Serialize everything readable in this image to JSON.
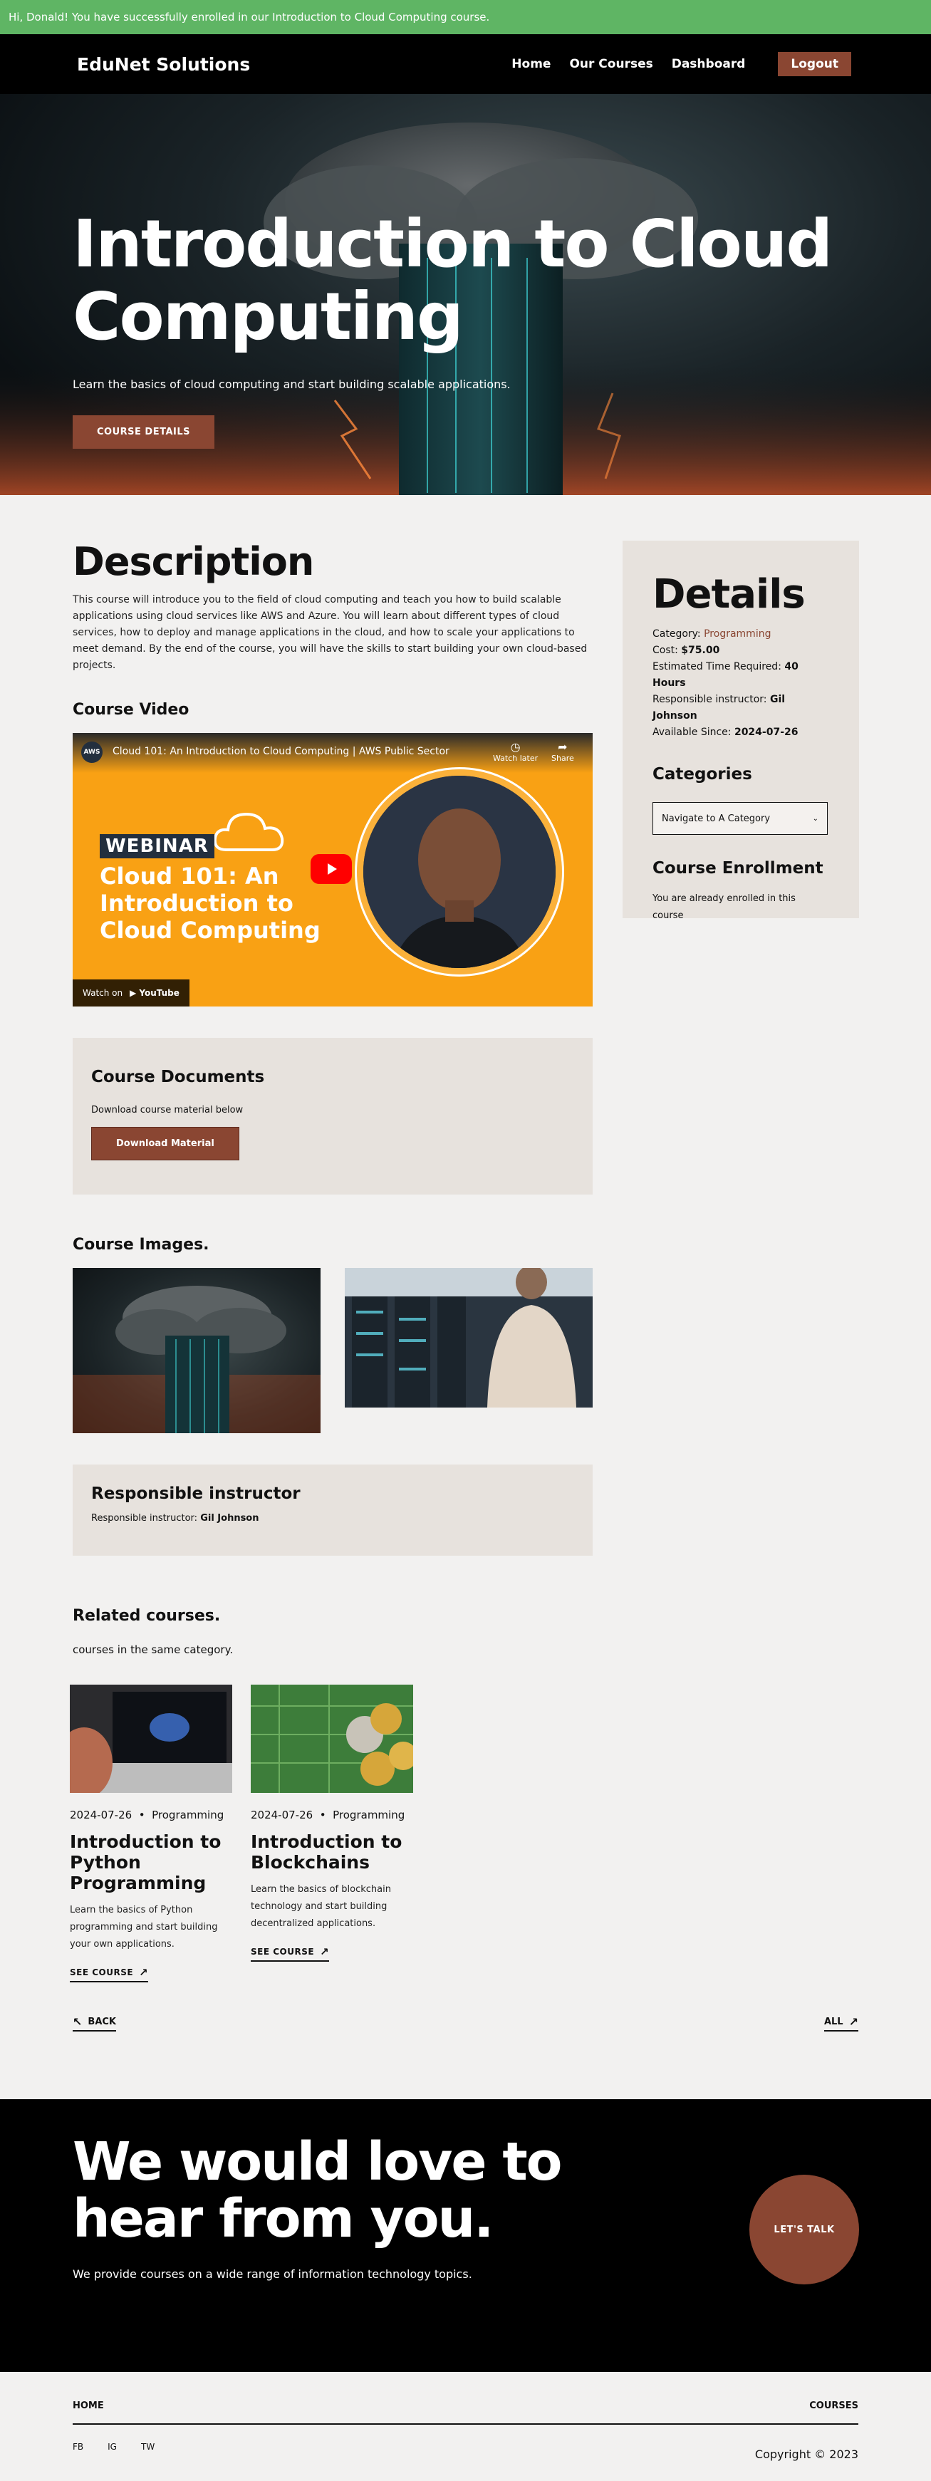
{
  "alert": {
    "message": "Hi, Donald! You have successfully enrolled in our Introduction to Cloud Computing course."
  },
  "header": {
    "brand": "EduNet Solutions",
    "nav": [
      "Home",
      "Our Courses",
      "Dashboard"
    ],
    "logout": "Logout"
  },
  "hero": {
    "title_line1": "Introduction to Cloud",
    "title_line2": "Computing",
    "subtitle": "Learn the basics of cloud computing and start building scalable applications.",
    "button": "COURSE DETAILS"
  },
  "description": {
    "heading": "Description",
    "text": "This course will introduce you to the field of cloud computing and teach you how to build scalable applications using cloud services like AWS and Azure. You will learn about different types of cloud services, how to deploy and manage applications in the cloud, and how to scale your applications to meet demand. By the end of the course, you will have the skills to start building your own cloud-based projects."
  },
  "video": {
    "section_heading": "Course Video",
    "title": "Cloud 101: An Introduction to Cloud Computing | AWS Public Sector",
    "channel_badge": "AWS",
    "watch_later": "Watch later",
    "share": "Share",
    "webinar_label": "WEBINAR",
    "heading_line1": "Cloud 101: An",
    "heading_line2": "Introduction to",
    "heading_line3": "Cloud Computing",
    "watch_on": "Watch on",
    "youtube": "YouTube"
  },
  "documents": {
    "heading": "Course Documents",
    "text": "Download course material below",
    "button": "Download Material"
  },
  "images": {
    "heading": "Course Images."
  },
  "instructor": {
    "heading": "Responsible instructor",
    "label": "Responsible instructor:",
    "name": "Gil Johnson"
  },
  "related": {
    "heading": "Related courses.",
    "subtitle": "courses in the same category.",
    "courses": [
      {
        "date": "2024-07-26",
        "category": "Programming",
        "title": "Introduction to Python Programming",
        "description": "Learn the basics of Python programming and start building your own applications.",
        "link": "SEE COURSE"
      },
      {
        "date": "2024-07-26",
        "category": "Programming",
        "title": "Introduction to Blockchains",
        "description": "Learn the basics of blockchain technology and start building decentralized applications.",
        "link": "SEE COURSE"
      }
    ],
    "separator": "•"
  },
  "pager": {
    "back": "BACK",
    "all": "ALL"
  },
  "details": {
    "heading": "Details",
    "category_label": "Category:",
    "category_value": "Programming",
    "cost_label": "Cost:",
    "cost_value": "$75.00",
    "time_label": "Estimated Time Required:",
    "time_value": "40 Hours",
    "instructor_label": "Responsible instructor:",
    "instructor_value": "Gil Johnson",
    "since_label": "Available Since:",
    "since_value": "2024-07-26",
    "categories_heading": "Categories",
    "select_value": "Navigate to A Category",
    "enrollment_heading": "Course Enrollment",
    "enrollment_text": "You are already enrolled in this course"
  },
  "contact": {
    "title_line1": "We would love to",
    "title_line2": "hear from you.",
    "subtitle": "We provide courses on a wide range of information technology topics.",
    "button": "LET'S TALK"
  },
  "footer": {
    "home": "HOME",
    "courses": "COURSES",
    "social": [
      "FB",
      "IG",
      "TW"
    ],
    "copyright": "Copyright © 2023"
  },
  "colors": {
    "accent": "#8a4632",
    "alert": "#5fb564",
    "card": "#e7e2dd",
    "background": "#f2f1f0",
    "video_orange": "#f9a114"
  }
}
